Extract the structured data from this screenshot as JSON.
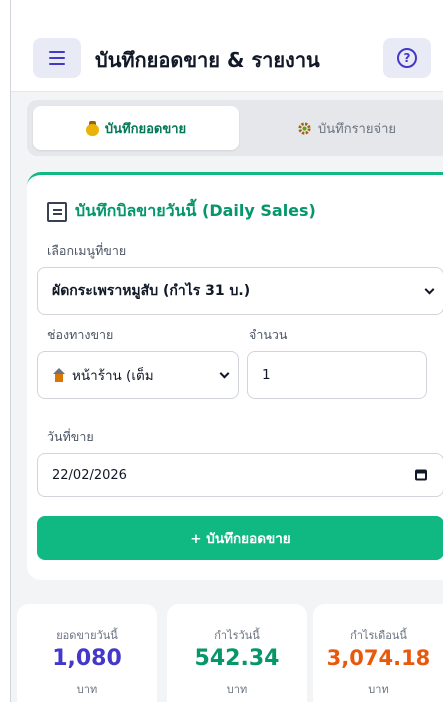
{
  "header": {
    "title": "บันทึกยอดขาย & รายงาน",
    "help_glyph": "?"
  },
  "tabs": [
    {
      "label": "บันทึกยอดขาย",
      "icon": "money-bag-icon",
      "active": true
    },
    {
      "label": "บันทึกรายจ่าย",
      "icon": "gear-icon",
      "active": false
    }
  ],
  "sales_form": {
    "title": "บันทึกบิลขายวันนี้ (Daily Sales)",
    "menu_label": "เลือกเมนูที่ขาย",
    "menu_value": "ผัดกระเพราหมูสับ (กำไร 31 บ.)",
    "channel_label": "ช่องทางขาย",
    "channel_value": "หน้าร้าน (เต็ม",
    "qty_label": "จำนวน",
    "qty_value": "1",
    "date_label": "วันที่ขาย",
    "date_value": "22/02/2026",
    "submit_label": "+ บันทึกยอดขาย"
  },
  "stats": [
    {
      "label": "ยอดขายวันนี้",
      "value": "1,080",
      "unit": "บาท",
      "color": "#4338ca"
    },
    {
      "label": "กำไรวันนี้",
      "value": "542.34",
      "unit": "บาท",
      "color": "#059669"
    },
    {
      "label": "กำไรเดือนนี้",
      "value": "3,074.18",
      "unit": "บาท",
      "color": "#ea580c"
    }
  ],
  "colors": {
    "accent": "#10b981",
    "primary": "#4338ca"
  }
}
